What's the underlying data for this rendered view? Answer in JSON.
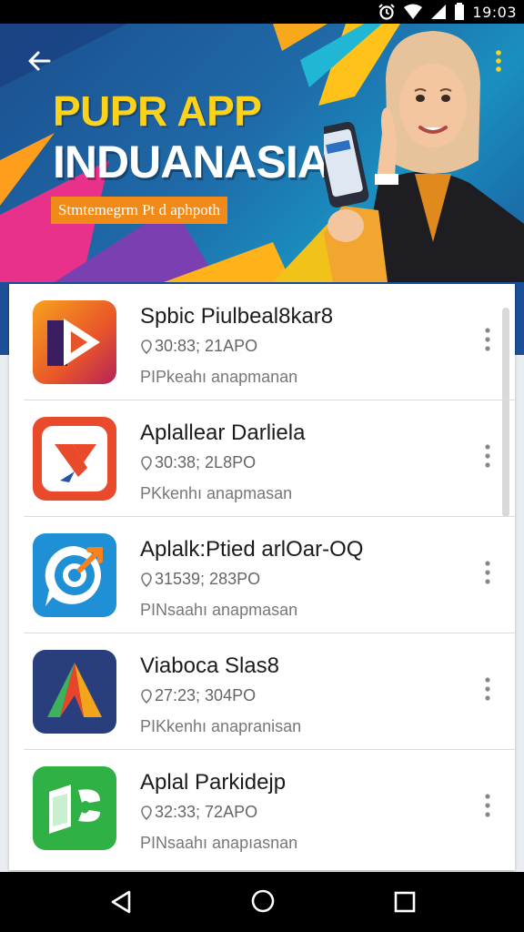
{
  "status_bar": {
    "time": "19:03"
  },
  "banner": {
    "title": "PUPR APP",
    "subtitle": "INDUANASIA",
    "tagline": "Stmtemegrm Pt d aphpoth"
  },
  "apps": [
    {
      "name": "Spbic Piulbeal8kar8",
      "meta": "30:83; 21APO",
      "description": "PIPkeahı anapmanan"
    },
    {
      "name": "Aplallear Darliela",
      "meta": "30:38; 2L8PO",
      "description": "PKkenhı anapmasan"
    },
    {
      "name": "Aplalk:Ptied arlOar-OQ",
      "meta": "31539; 283PO",
      "description": "PINsaahı anapmasan"
    },
    {
      "name": "Viaboca Slas8",
      "meta": "27:23; 304PO",
      "description": "PIKkenhı anapranisan"
    },
    {
      "name": "Aplal Parkidejp",
      "meta": "32:33; 72APO",
      "description": "PINsaahı anapıasnan"
    }
  ],
  "colors": {
    "banner_blue": "#1f6aa8",
    "title_yellow": "#ffd21a",
    "tag_orange": "#f28a1a",
    "strip_blue": "#1c4f97"
  }
}
